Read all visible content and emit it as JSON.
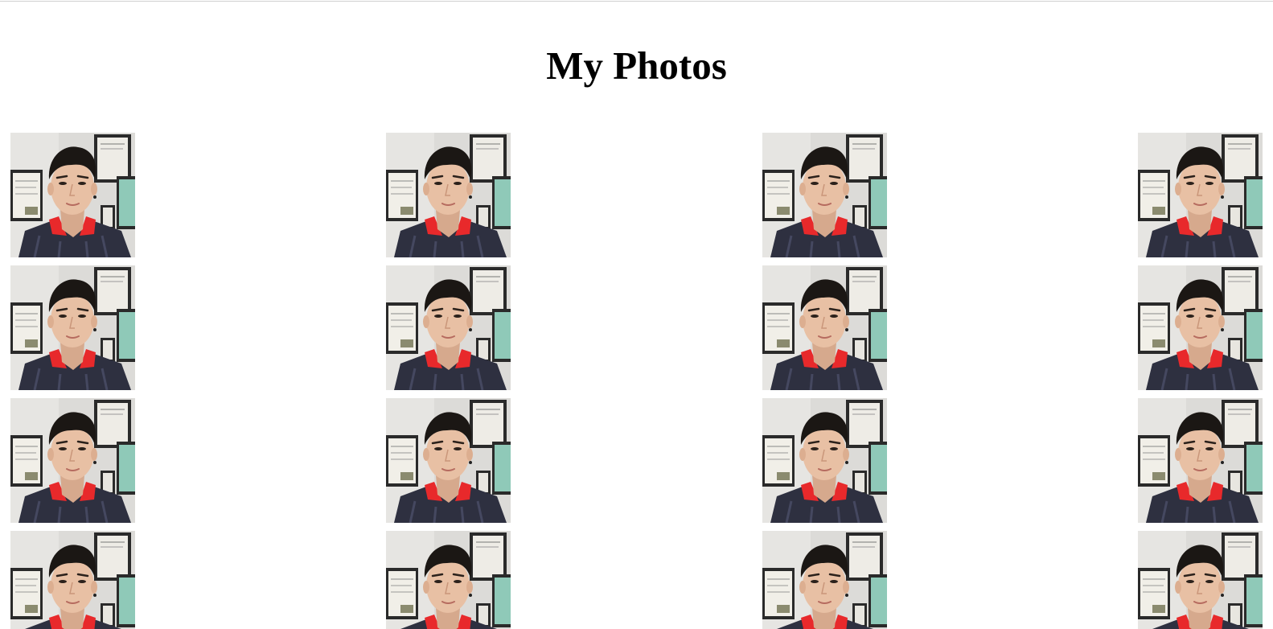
{
  "page": {
    "title": "My Photos"
  },
  "gallery": {
    "photo_subject": "portrait-selfie",
    "photos": [
      {
        "id": 1
      },
      {
        "id": 2
      },
      {
        "id": 3
      },
      {
        "id": 4
      },
      {
        "id": 5
      },
      {
        "id": 6
      },
      {
        "id": 7
      },
      {
        "id": 8
      },
      {
        "id": 9
      },
      {
        "id": 10
      },
      {
        "id": 11
      },
      {
        "id": 12
      },
      {
        "id": 13
      },
      {
        "id": 14
      },
      {
        "id": 15
      },
      {
        "id": 16
      }
    ]
  },
  "colors": {
    "background": "#ffffff",
    "title": "#000000",
    "wall": "#d9d8d6",
    "shirt": "#2e3040",
    "collar": "#e8292b",
    "skin": "#e8c0a4",
    "hair": "#1b1714",
    "frame": "#2a2a2a",
    "frame_green": "#8fc9b8"
  }
}
